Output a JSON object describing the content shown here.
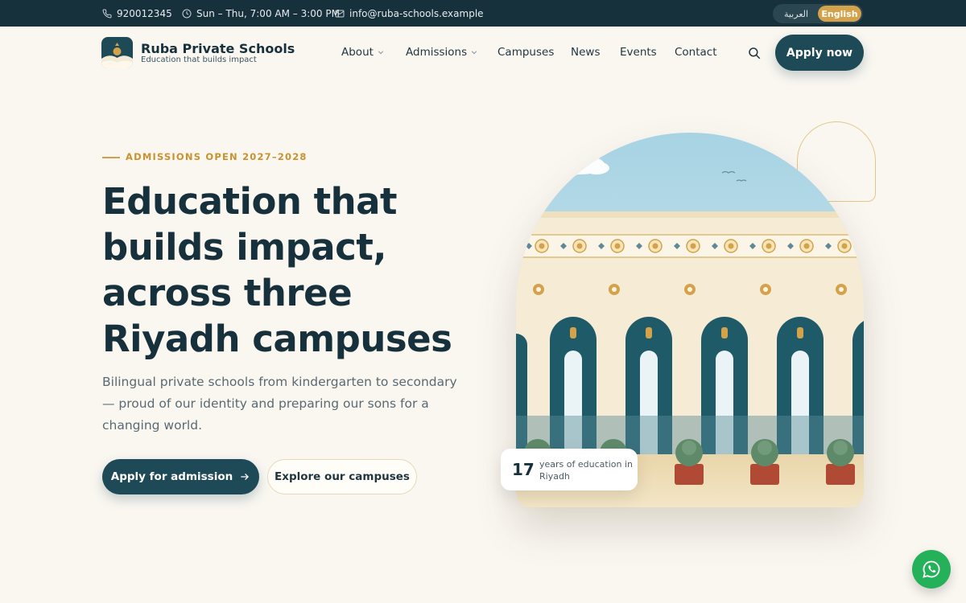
{
  "topbar": {
    "phone": "920012345",
    "hours": "Sun – Thu, 7:00 AM – 3:00 PM",
    "email": "info@ruba-schools.example",
    "lang_ar": "العربية",
    "lang_en": "English",
    "active_language": "English"
  },
  "header": {
    "brand_name": "Ruba Private Schools",
    "brand_tagline": "Education that builds impact",
    "nav": [
      {
        "label": "About",
        "has_dropdown": true
      },
      {
        "label": "Admissions",
        "has_dropdown": true
      },
      {
        "label": "Campuses",
        "has_dropdown": false
      },
      {
        "label": "News",
        "has_dropdown": false
      },
      {
        "label": "Events",
        "has_dropdown": false
      },
      {
        "label": "Contact",
        "has_dropdown": false
      }
    ],
    "apply_label": "Apply now"
  },
  "hero": {
    "eyebrow": "ADMISSIONS OPEN 2027–2028",
    "headline": "Education that builds impact, across three Riyadh campuses",
    "lead": "Bilingual private schools from kindergarten to secondary — proud of our identity and preparing our sons for a changing world.",
    "primary_cta": "Apply for admission",
    "secondary_cta": "Explore our campuses",
    "stat_value": "17",
    "stat_label": "years of education in Riyadh"
  },
  "colors": {
    "primary": "#1e4a57",
    "dark": "#17313c",
    "accent": "#d4a24a",
    "background": "#faf7f1",
    "whatsapp": "#25b05a"
  },
  "icons": {
    "phone": "phone-icon",
    "clock": "clock-icon",
    "mail": "mail-icon",
    "search": "search-icon",
    "arrow": "arrow-right-icon",
    "whatsapp": "whatsapp-icon"
  }
}
